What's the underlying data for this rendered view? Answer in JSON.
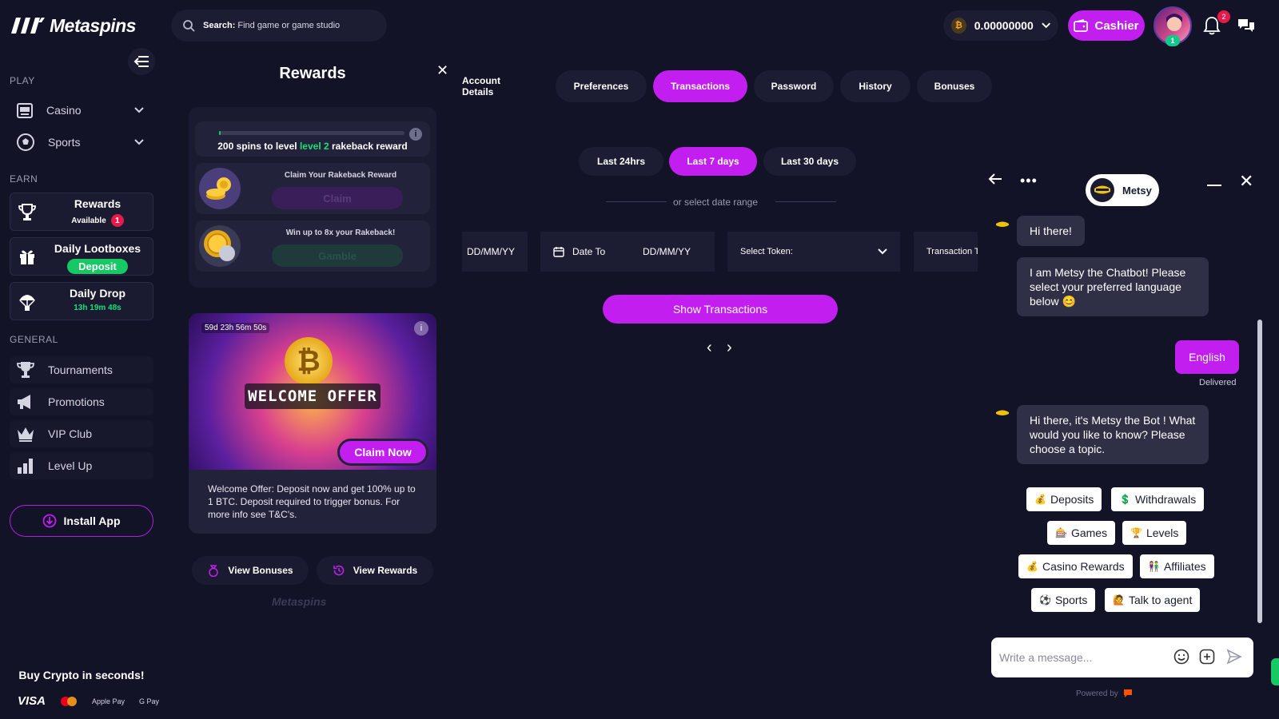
{
  "header": {
    "brand": "Metaspins",
    "search": {
      "label": "Search:",
      "placeholder": "Find game or game studio"
    },
    "balance": {
      "amount": "0.00000000",
      "currency_symbol": "₿"
    },
    "cashier_label": "Cashier",
    "avatar_level": "1",
    "notification_count": "2"
  },
  "sidebar": {
    "play_label": "PLAY",
    "play_items": [
      {
        "label": "Casino",
        "icon": "casino-icon"
      },
      {
        "label": "Sports",
        "icon": "soccer-ball-icon"
      }
    ],
    "earn_label": "EARN",
    "earn_items": [
      {
        "title": "Rewards",
        "sub": "Available",
        "badge": "1",
        "icon": "trophy-icon"
      },
      {
        "title": "Daily Lootboxes",
        "sub": "Deposit",
        "icon": "gift-icon"
      },
      {
        "title": "Daily Drop",
        "sub": "13h 19m 48s",
        "icon": "parachute-icon"
      }
    ],
    "general_label": "GENERAL",
    "general_items": [
      {
        "label": "Tournaments",
        "icon": "trophy-icon"
      },
      {
        "label": "Promotions",
        "icon": "megaphone-icon"
      },
      {
        "label": "VIP Club",
        "icon": "crown-icon"
      },
      {
        "label": "Level Up",
        "icon": "bar-chart-icon"
      }
    ],
    "install_label": "Install App",
    "buy_crypto": "Buy Crypto in seconds!",
    "payment_methods": [
      "VISA",
      "Mastercard",
      "Apple Pay",
      "G Pay"
    ]
  },
  "rewards": {
    "title": "Rewards",
    "progress": {
      "fraction": 0.01,
      "prefix": "200 spins to level",
      "level": "level 2",
      "suffix": "rakeback reward"
    },
    "rakeback_caption": "Claim Your Rakeback Reward",
    "claim_label": "Claim",
    "gamble_caption": "Win up to 8x your Rakeback!",
    "gamble_label": "Gamble",
    "promo": {
      "timer": "59d 23h 56m 50s",
      "banner_text": "WELCOME OFFER",
      "claim_now": "Claim Now",
      "description": "Welcome Offer: Deposit now and get 100% up to 1 BTC. Deposit required to trigger bonus. For more info see T&C's."
    },
    "view_bonuses": "View Bonuses",
    "view_rewards": "View Rewards",
    "footer_brand": "Metaspins"
  },
  "account": {
    "tabs": [
      "Account Details",
      "Preferences",
      "Transactions",
      "Password",
      "History",
      "Bonuses"
    ],
    "active_tab": "Transactions",
    "ranges": [
      "Last 24hrs",
      "Last 7 days",
      "Last 30 days"
    ],
    "active_range": "Last 7 days",
    "date_range_text": "or select date range",
    "date_from_value": "DD/MM/YY",
    "date_to_label": "Date To",
    "date_to_value": "DD/MM/YY",
    "token_label": "Select Token:",
    "type_label": "Transaction Ty",
    "show_button": "Show Transactions"
  },
  "chat": {
    "bot_name": "Metsy",
    "messages": [
      {
        "from": "bot",
        "text": "Hi there!"
      },
      {
        "from": "bot",
        "text": "I am Metsy the Chatbot! Please select your preferred language below 😊"
      },
      {
        "from": "user",
        "text": "English",
        "status": "Delivered"
      },
      {
        "from": "bot",
        "text": "Hi there, it's Metsy the Bot ! What would you like to know? Please choose a topic."
      }
    ],
    "options": [
      {
        "emoji": "💰",
        "label": "Deposits"
      },
      {
        "emoji": "💲",
        "label": "Withdrawals"
      },
      {
        "emoji": "🎰",
        "label": "Games"
      },
      {
        "emoji": "🏆",
        "label": "Levels"
      },
      {
        "emoji": "💰",
        "label": "Casino Rewards"
      },
      {
        "emoji": "👫",
        "label": "Affiliates"
      },
      {
        "emoji": "⚽",
        "label": "Sports"
      },
      {
        "emoji": "🙋",
        "label": "Talk to agent"
      }
    ],
    "composer_placeholder": "Write a message...",
    "powered_by": "Powered by"
  },
  "colors": {
    "accent": "#c21ef0",
    "bg": "#121326",
    "card": "#1c1d33",
    "success": "#17c964",
    "danger": "#e6194b"
  }
}
